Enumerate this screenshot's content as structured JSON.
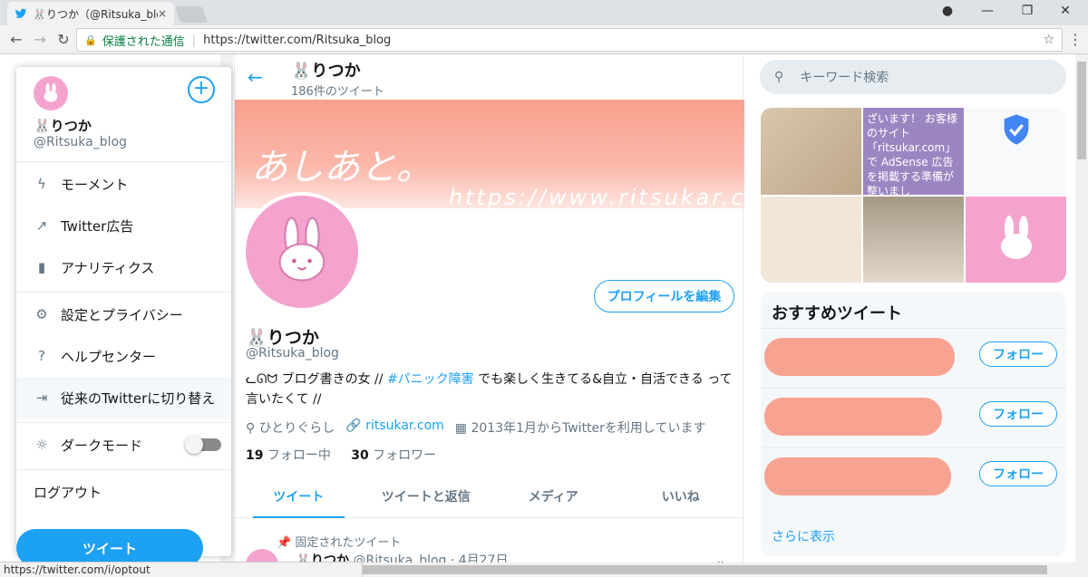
{
  "browser": {
    "tab_title": "🐰りつか（@Ritsuka_blog",
    "tab_close": "×",
    "secure_label": "保護された通信",
    "url": "https://twitter.com/Ritsuka_blog",
    "status_url": "https://twitter.com/i/optout"
  },
  "drawer": {
    "name": "🐰りつか",
    "handle": "@Ritsuka_blog",
    "items": [
      {
        "label": "モーメント",
        "icon": "lightning-icon"
      },
      {
        "label": "Twitter広告",
        "icon": "external-link-icon"
      },
      {
        "label": "アナリティクス",
        "icon": "bar-chart-icon"
      },
      {
        "label": "設定とプライバシー",
        "icon": "gear-icon"
      },
      {
        "label": "ヘルプセンター",
        "icon": "help-icon"
      },
      {
        "label": "従来のTwitterに切り替え",
        "icon": "switch-icon"
      },
      {
        "label": "ダークモード",
        "icon": "lightbulb-icon"
      },
      {
        "label": "ログアウト",
        "icon": ""
      }
    ],
    "dark_mode": false,
    "tweet_button": "ツイート"
  },
  "profile": {
    "header_name": "🐰りつか",
    "tweet_count": "186件のツイート",
    "banner_text": "あしあと。",
    "banner_url": "https://www.ritsukar.com",
    "edit_button": "プロフィールを編集",
    "name": "🐰りつか",
    "handle": "@Ritsuka_blog",
    "bio_pre": "ᓚᘏᗢ ブログ書きの女 // ",
    "bio_tag": "#パニック障害",
    "bio_post": " でも楽しく生きてる&自立・自活できる って言いたくて //",
    "location": "ひとりぐらし",
    "website": "ritsukar.com",
    "joined": "2013年1月からTwitterを利用しています",
    "following_count": "19",
    "following_label": " フォロー中",
    "followers_count": "30",
    "followers_label": " フォロワー",
    "tabs": [
      "ツイート",
      "ツイートと返信",
      "メディア",
      "いいね"
    ],
    "pinned_label": "固定されたツイート",
    "tweet_name": "🐰りつか",
    "tweet_meta": "@Ritsuka_blog · 4月27日"
  },
  "right": {
    "search_placeholder": "キーワード検索",
    "media_text": "ざいます！ お客様のサイト「ritsukar.com」で AdSense 広告を掲載する準備が整いまし",
    "recommend_title": "おすすめツイート",
    "follow_label": "フォロー",
    "show_more": "さらに表示"
  },
  "colors": {
    "accent": "#1da1f2",
    "avatar_pink": "#f4a3cf",
    "banner_salmon": "#f9a08e"
  }
}
